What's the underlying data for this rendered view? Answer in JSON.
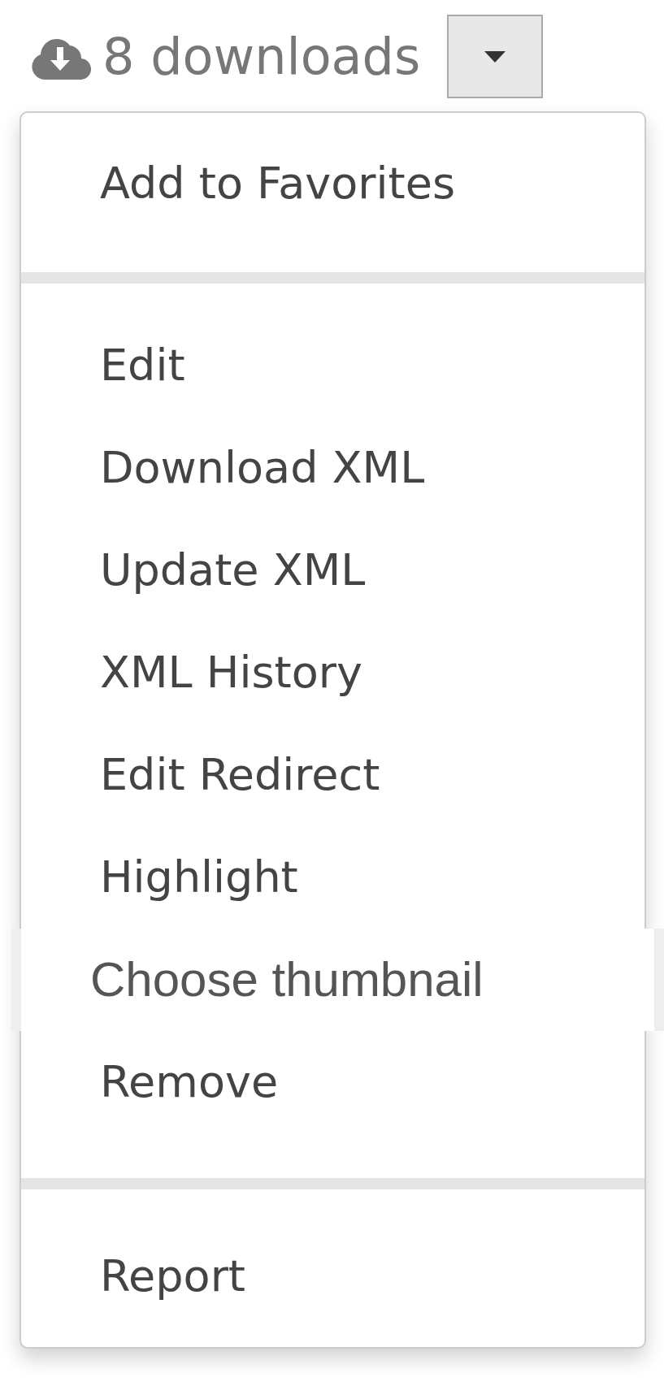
{
  "downloads": {
    "label": "8 downloads"
  },
  "dropdown_toggle": {
    "expanded": true
  },
  "menu": {
    "sections": [
      {
        "items": [
          {
            "label": "Add to Favorites",
            "hovered": false
          }
        ]
      },
      {
        "items": [
          {
            "label": "Edit",
            "hovered": false
          },
          {
            "label": "Download XML",
            "hovered": false
          },
          {
            "label": "Update XML",
            "hovered": false
          },
          {
            "label": "XML History",
            "hovered": false
          },
          {
            "label": "Edit Redirect",
            "hovered": false
          },
          {
            "label": "Highlight",
            "hovered": false
          },
          {
            "label": "Choose thumbnail",
            "hovered": true
          },
          {
            "label": "Remove",
            "hovered": false
          }
        ]
      },
      {
        "items": [
          {
            "label": "Report",
            "hovered": false
          }
        ]
      }
    ]
  }
}
